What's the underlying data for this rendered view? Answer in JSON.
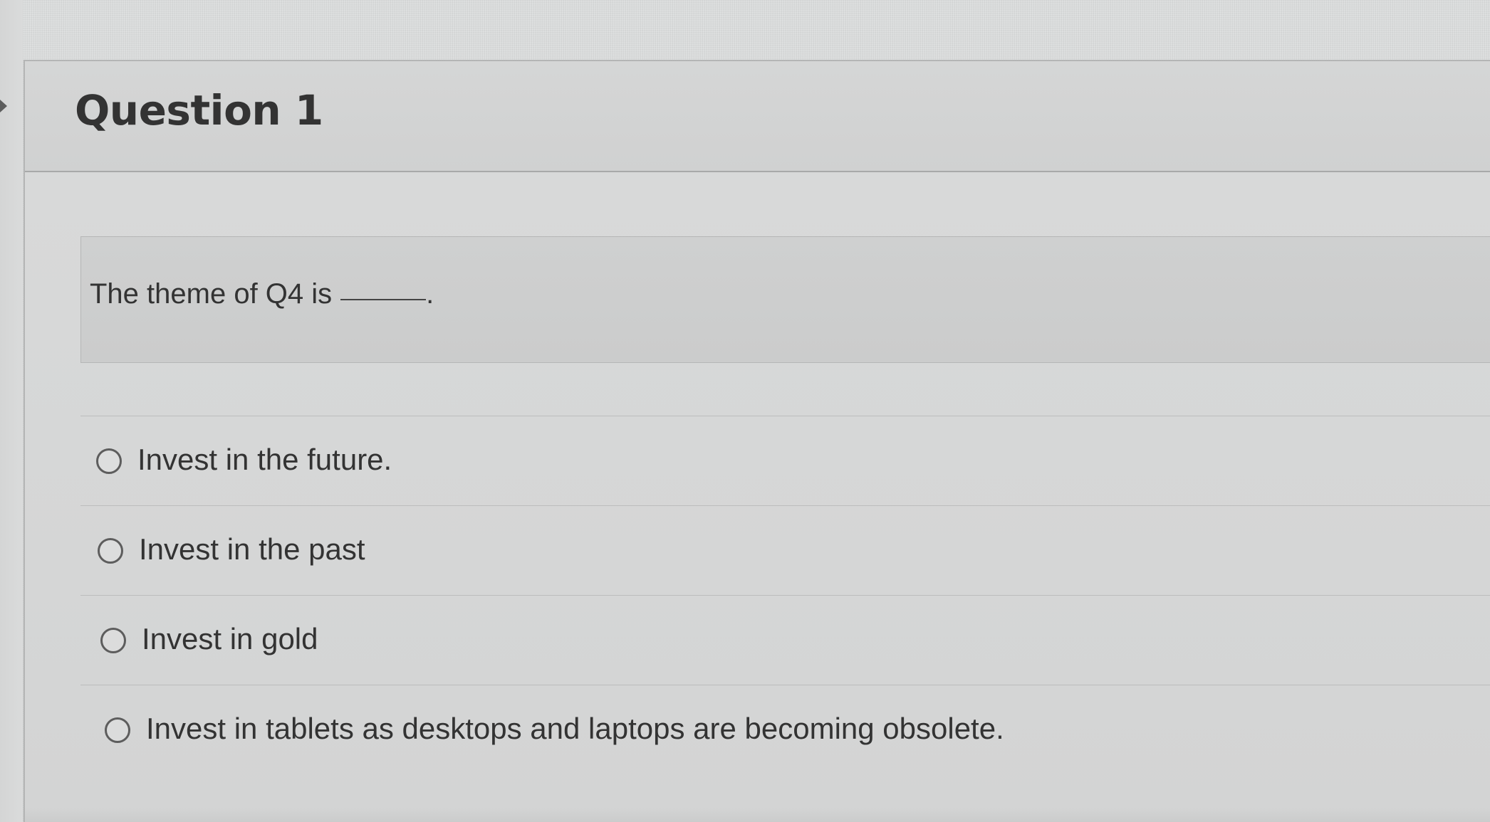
{
  "question": {
    "title": "Question 1",
    "prompt": "The theme of Q4 is",
    "blank_suffix": "."
  },
  "answers": [
    {
      "label": "Invest in the future."
    },
    {
      "label": "Invest in the past"
    },
    {
      "label": "Invest in gold"
    },
    {
      "label": "Invest in tablets as desktops and laptops are becoming obsolete."
    }
  ],
  "theme": {
    "background": "#d7d8d8",
    "text": "#333333",
    "border": "#b5b6b6"
  }
}
